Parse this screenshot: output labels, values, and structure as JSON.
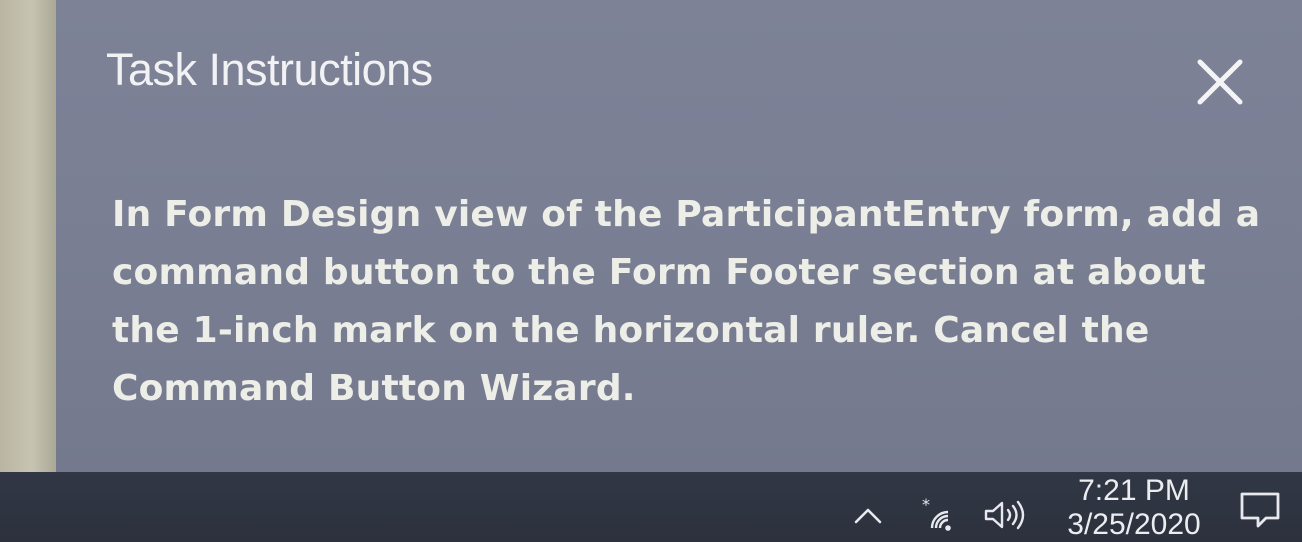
{
  "task_panel": {
    "title": "Task Instructions",
    "instruction": "In Form Design view of the ParticipantEntry form, add a command button to the Form Footer section at about the 1-inch mark on the horizontal ruler. Cancel the Command Button Wizard.",
    "close_icon": "close-icon"
  },
  "taskbar": {
    "tray_icons": [
      "chevron-up-icon",
      "wifi-icon",
      "speaker-icon",
      "notification-icon"
    ],
    "clock": {
      "time": "7:21 PM",
      "date": "3/25/2020"
    }
  },
  "colors": {
    "panel_background": "#7a7f94",
    "taskbar_background": "#2f3440",
    "text": "#eeeee8"
  }
}
